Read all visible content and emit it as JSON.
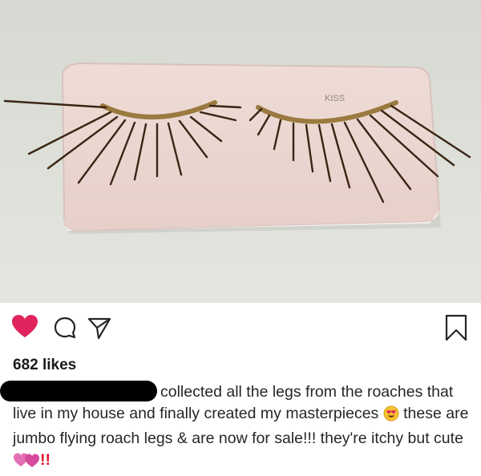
{
  "post": {
    "photo": {
      "brand_label": "KISS"
    },
    "actions": {
      "like_icon": "heart-icon",
      "comment_icon": "comment-icon",
      "share_icon": "share-icon",
      "save_icon": "bookmark-icon",
      "liked_color": "#e0245e"
    },
    "likes_text": "682 likes",
    "caption": {
      "username": "",
      "part1": "collected all the legs from the roaches that live in my house and finally created my masterpieces",
      "emoji1": "smiling-face-with-heart-eyes",
      "part2": "these are jumbo flying roach legs & are now for sale!!! they're itchy but cute",
      "emoji2": "two-hearts",
      "exclaim": "!!"
    }
  }
}
